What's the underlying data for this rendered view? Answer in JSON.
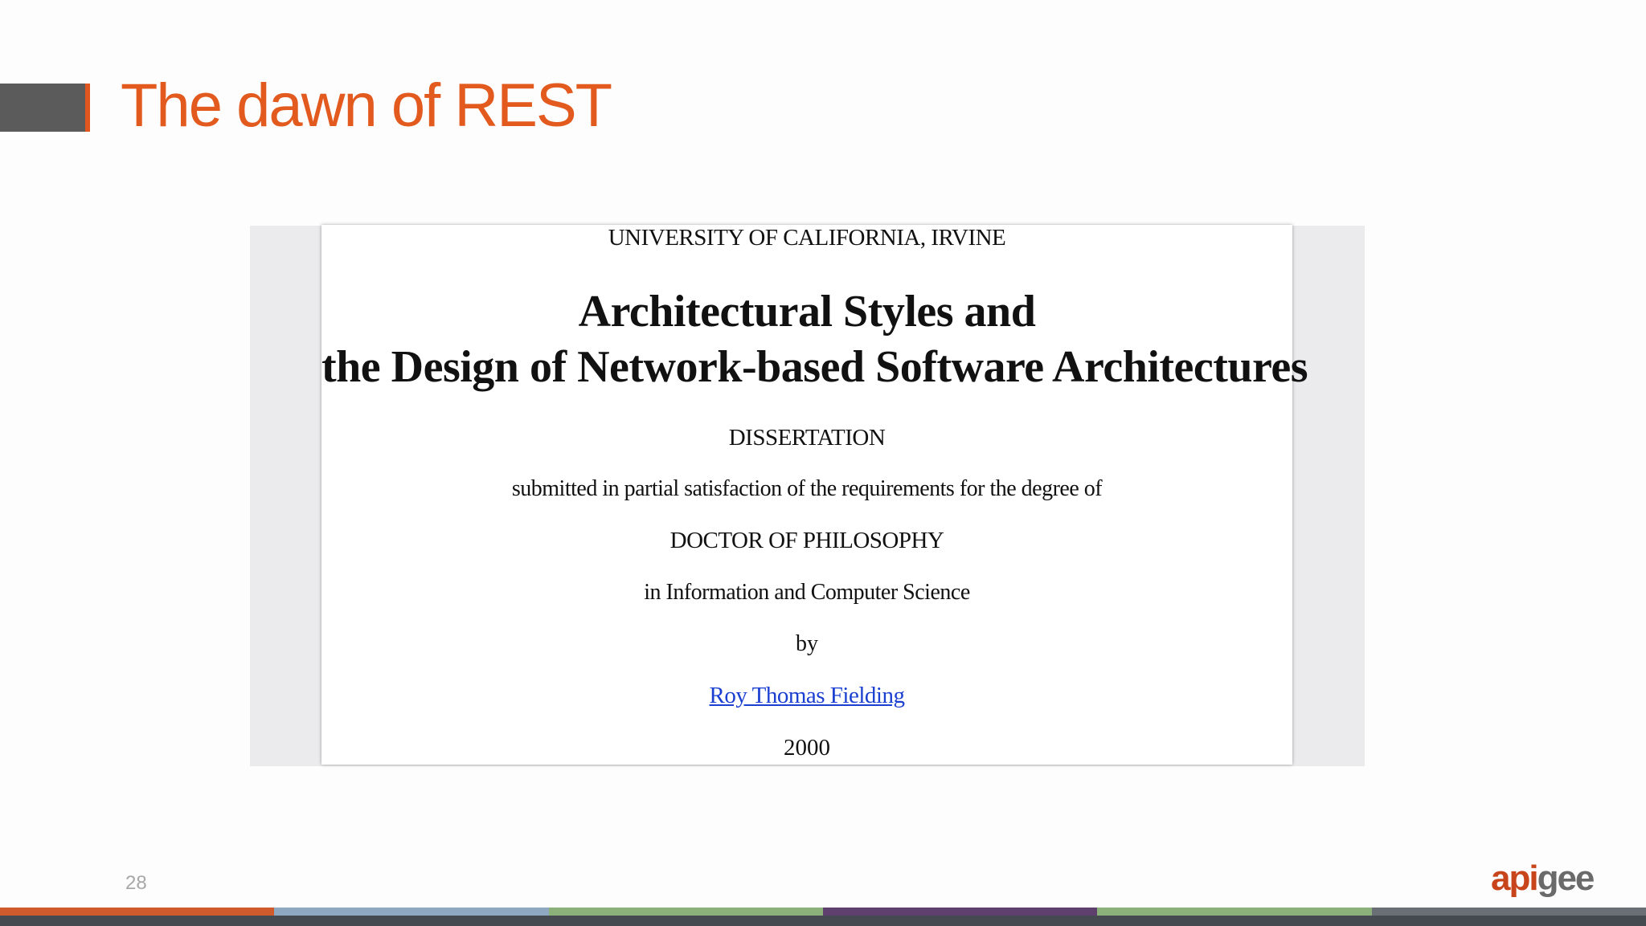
{
  "slide": {
    "title": "The dawn of REST",
    "number": "28",
    "logo": {
      "part1": "api",
      "part2": "gee"
    }
  },
  "document": {
    "university": "UNIVERSITY OF CALIFORNIA, IRVINE",
    "title_line1": "Architectural Styles and",
    "title_line2": "the Design of Network-based Software Architectures",
    "type": "DISSERTATION",
    "submitted": "submitted in partial satisfaction of the requirements for the degree of",
    "degree": "DOCTOR OF PHILOSOPHY",
    "field": "in Information and Computer Science",
    "by": "by",
    "author": "Roy Thomas Fielding",
    "year": "2000"
  },
  "colors": {
    "title": "#e35a1f",
    "title_block": "#5b5b5b",
    "link": "#1a3fd1",
    "footer_stripes": [
      "#cf5a2c",
      "#8fa8c2",
      "#8cb07a",
      "#5e3f6e",
      "#8cb07a",
      "#6a6f75"
    ]
  }
}
